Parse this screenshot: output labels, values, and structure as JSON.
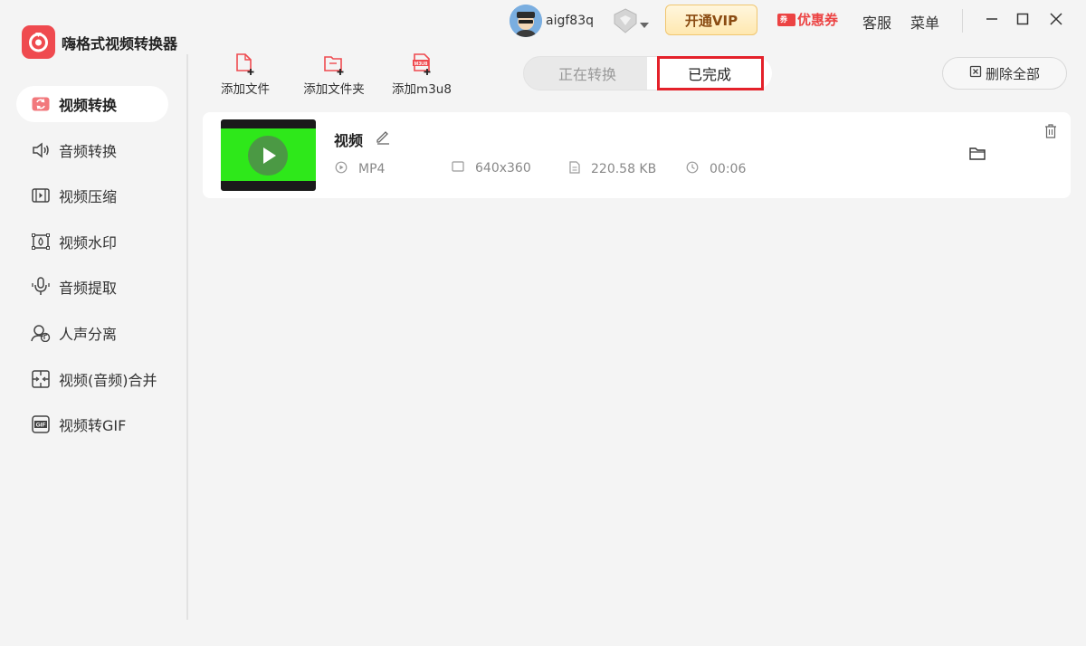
{
  "app": {
    "title": "嗨格式视频转换器",
    "brand_color": "#ef4a4f"
  },
  "sidebar": {
    "items": [
      {
        "label": "视频转换",
        "icon": "video-convert-icon",
        "active": true
      },
      {
        "label": "音频转换",
        "icon": "audio-convert-icon"
      },
      {
        "label": "视频压缩",
        "icon": "video-compress-icon"
      },
      {
        "label": "视频水印",
        "icon": "video-watermark-icon"
      },
      {
        "label": "音频提取",
        "icon": "audio-extract-icon"
      },
      {
        "label": "人声分离",
        "icon": "vocal-separation-icon"
      },
      {
        "label": "视频(音频)合并",
        "icon": "merge-icon"
      },
      {
        "label": "视频转GIF",
        "icon": "gif-icon"
      }
    ]
  },
  "header": {
    "username": "aigf83q",
    "vip_label": "开通VIP",
    "coupon_label": "优惠券",
    "coupon_badge": "券",
    "service_label": "客服",
    "menu_label": "菜单",
    "accent_red": "#ec4343"
  },
  "toolbar": {
    "add_file": "添加文件",
    "add_folder": "添加文件夹",
    "add_m3u8": "添加m3u8",
    "m3u8_badge": "M3U8"
  },
  "tabs": {
    "converting": "正在转换",
    "done": "已完成",
    "selected": "done"
  },
  "delete_all_label": "删除全部",
  "files": [
    {
      "name": "视频",
      "format": "MP4",
      "resolution": "640x360",
      "size": "220.58 KB",
      "duration": "00:06"
    }
  ]
}
